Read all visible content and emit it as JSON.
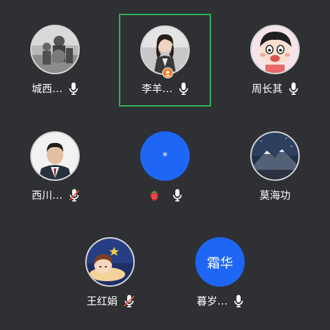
{
  "participants": [
    {
      "name": "城西…",
      "mic": "on",
      "avatar": "photo-people-outdoor"
    },
    {
      "name": "李羊…",
      "mic": "on",
      "avatar": "photo-woman-portrait",
      "speaking": true,
      "host": true
    },
    {
      "name": "周长其",
      "mic": "on",
      "avatar": "cartoon-crayon-shin-chan"
    },
    {
      "name": "西川…",
      "mic": "muted",
      "avatar": "photo-man-portrait"
    },
    {
      "name": "",
      "mic": "on",
      "avatar_text": "*",
      "name_icon": "strawberry-emoji"
    },
    {
      "name": "莫海功",
      "mic": "none",
      "avatar": "photo-mountain-night"
    },
    {
      "name": "王红娟",
      "mic": "muted",
      "avatar": "illustration-moon-girl"
    },
    {
      "name": "暮岁…",
      "mic": "on",
      "avatar_text": "霜华"
    }
  ],
  "colors": {
    "background": "#2f3034",
    "speaking_border": "#35b15b",
    "text_avatar": "#1e66f5",
    "muted_slash": "#e74c3c",
    "host_badge": "#f07d2a"
  }
}
